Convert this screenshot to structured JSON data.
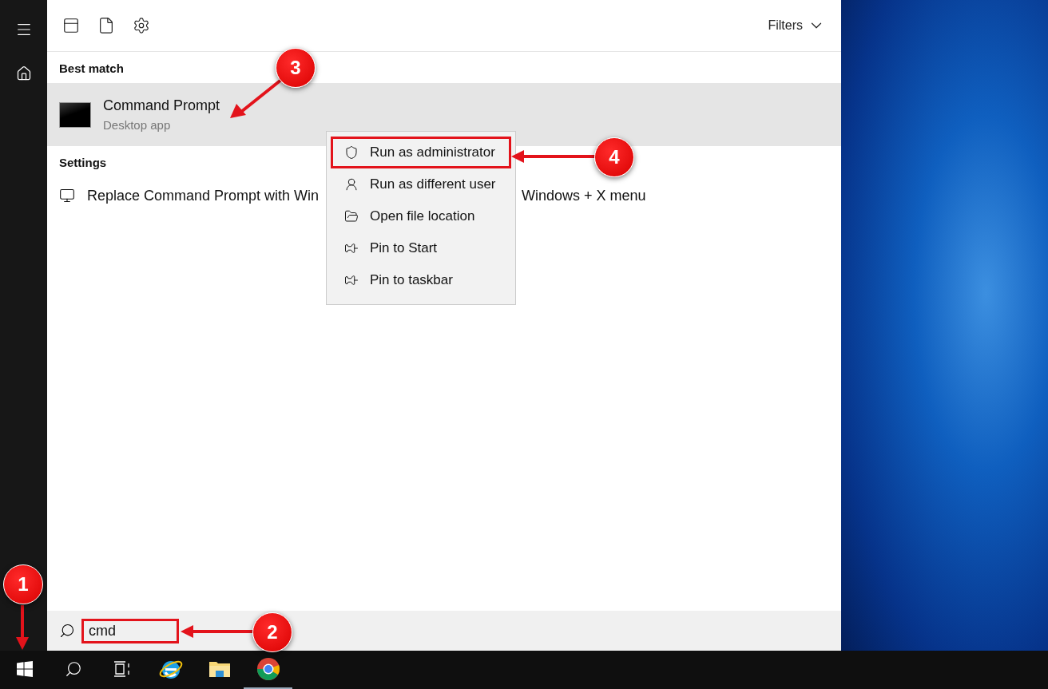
{
  "toolbar": {
    "filters": "Filters"
  },
  "results": [
    {
      "heading": "Best match",
      "items": [
        {
          "kind": "app",
          "title": "Command Prompt",
          "subtitle": "Desktop app",
          "selected": true
        }
      ]
    },
    {
      "heading": "Settings",
      "items": [
        {
          "kind": "setting",
          "title": "Replace Command Prompt with Win",
          "title_continued": "Windows + X menu",
          "selected": false
        }
      ]
    }
  ],
  "context_menu": {
    "items": [
      {
        "kind": "admin",
        "label": "Run as administrator",
        "outlined": true
      },
      {
        "kind": "user",
        "label": "Run as different user",
        "outlined": false
      },
      {
        "kind": "folder",
        "label": "Open file location",
        "outlined": false
      },
      {
        "kind": "pin",
        "label": "Pin to Start",
        "outlined": false
      },
      {
        "kind": "pin",
        "label": "Pin to taskbar",
        "outlined": false
      }
    ]
  },
  "search": {
    "value": "cmd"
  },
  "annotations": [
    {
      "label": "1"
    },
    {
      "label": "2"
    },
    {
      "label": "3"
    },
    {
      "label": "4"
    }
  ]
}
